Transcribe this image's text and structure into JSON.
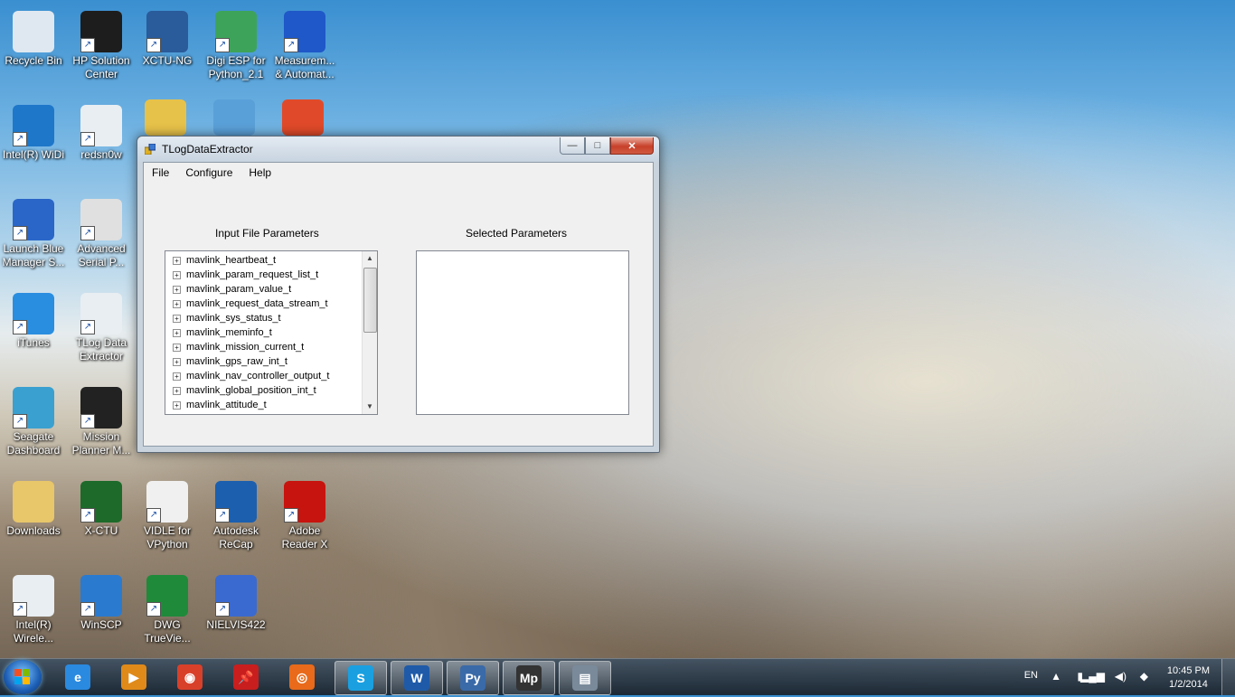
{
  "desktop": {
    "icons": [
      {
        "label": "Recycle Bin",
        "icon": "recycle-bin-icon",
        "color": "#dfe8f0"
      },
      {
        "label": "HP Solution Center",
        "icon": "hp-logo-icon",
        "color": "#1d1d1d"
      },
      {
        "label": "XCTU-NG",
        "icon": "xbee-board-icon",
        "color": "#2a5b9a"
      },
      {
        "label": "Digi ESP for Python_2.1",
        "icon": "esp-icon",
        "color": "#3ea35a"
      },
      {
        "label": "Measurem... & Automat...",
        "icon": "measurement-icon",
        "color": "#1f58c8"
      },
      {
        "label": "Intel(R) WiDi",
        "icon": "widi-icon",
        "color": "#1e77c9"
      },
      {
        "label": "redsn0w",
        "icon": "app-window-icon",
        "color": "#e8eef2"
      },
      {
        "label": "Launch Blue Manager S...",
        "icon": "bluetooth-icon",
        "color": "#2a66c8"
      },
      {
        "label": "Advanced Serial P...",
        "icon": "serial-port-icon",
        "color": "#e0e0e0"
      },
      {
        "label": "iTunes",
        "icon": "itunes-icon",
        "color": "#2a8ee0"
      },
      {
        "label": "TLog Data Extractor",
        "icon": "app-window-icon",
        "color": "#e8eef2"
      },
      {
        "label": "Seagate Dashboard",
        "icon": "seagate-icon",
        "color": "#3aa0d0"
      },
      {
        "label": "Mission Planner M...",
        "icon": "mission-planner-icon",
        "color": "#222"
      },
      {
        "label": "Downloads",
        "icon": "folder-icon",
        "color": "#e8c66a"
      },
      {
        "label": "X-CTU",
        "icon": "xctu-icon",
        "color": "#1d6a2a"
      },
      {
        "label": "VIDLE for VPython",
        "icon": "python-icon",
        "color": "#f0f0f0"
      },
      {
        "label": "Autodesk ReCap",
        "icon": "recap-icon",
        "color": "#1c5fae"
      },
      {
        "label": "Adobe Reader X",
        "icon": "adobe-reader-icon",
        "color": "#c8140e"
      },
      {
        "label": "Intel(R) Wirele...",
        "icon": "app-window-icon",
        "color": "#e8eef2"
      },
      {
        "label": "WinSCP",
        "icon": "winscp-icon",
        "color": "#2a7ad0"
      },
      {
        "label": "DWG TrueVie...",
        "icon": "dwg-icon",
        "color": "#1f8a3a"
      },
      {
        "label": "NIELVIS422",
        "icon": "archive-icon",
        "color": "#3a6ad0"
      }
    ],
    "partial_icons": [
      {
        "icon": "font-icon",
        "color": "#e7c24a"
      },
      {
        "icon": "swirl-icon",
        "color": "#5aa0d8"
      },
      {
        "icon": "antivirus-icon",
        "color": "#e04a2a"
      }
    ]
  },
  "window": {
    "title": "TLogDataExtractor",
    "controls": {
      "minimize": "—",
      "maximize": "□",
      "close": "✕"
    },
    "menu": [
      "File",
      "Configure",
      "Help"
    ],
    "input_label": "Input File Parameters",
    "selected_label": "Selected Parameters",
    "tree_items": [
      "mavlink_heartbeat_t",
      "mavlink_param_request_list_t",
      "mavlink_param_value_t",
      "mavlink_request_data_stream_t",
      "mavlink_sys_status_t",
      "mavlink_meminfo_t",
      "mavlink_mission_current_t",
      "mavlink_gps_raw_int_t",
      "mavlink_nav_controller_output_t",
      "mavlink_global_position_int_t",
      "mavlink_attitude_t"
    ],
    "expand_glyph": "+",
    "selected_items": []
  },
  "taskbar": {
    "pinned": [
      {
        "icon": "internet-explorer-icon",
        "glyph": "e",
        "color": "#2a8ae0"
      },
      {
        "icon": "media-player-icon",
        "glyph": "▶",
        "color": "#e08a1a"
      },
      {
        "icon": "chrome-icon",
        "glyph": "◉",
        "color": "#d9402a"
      },
      {
        "icon": "pushpin-icon",
        "glyph": "📌",
        "color": "#c81e1e"
      },
      {
        "icon": "firefox-icon",
        "glyph": "◎",
        "color": "#e86a1a"
      },
      {
        "icon": "skype-icon",
        "glyph": "S",
        "color": "#1aa0e0"
      },
      {
        "icon": "word-icon",
        "glyph": "W",
        "color": "#1e5aa8"
      },
      {
        "icon": "python-icon",
        "glyph": "Py",
        "color": "#3a6aa8"
      },
      {
        "icon": "mission-planner-icon",
        "glyph": "Mp",
        "color": "#333"
      },
      {
        "icon": "tlog-app-icon",
        "glyph": "▤",
        "color": "#7a8a9a"
      }
    ],
    "tray": {
      "language": "EN",
      "time": "10:45 PM",
      "date": "1/2/2014"
    }
  }
}
